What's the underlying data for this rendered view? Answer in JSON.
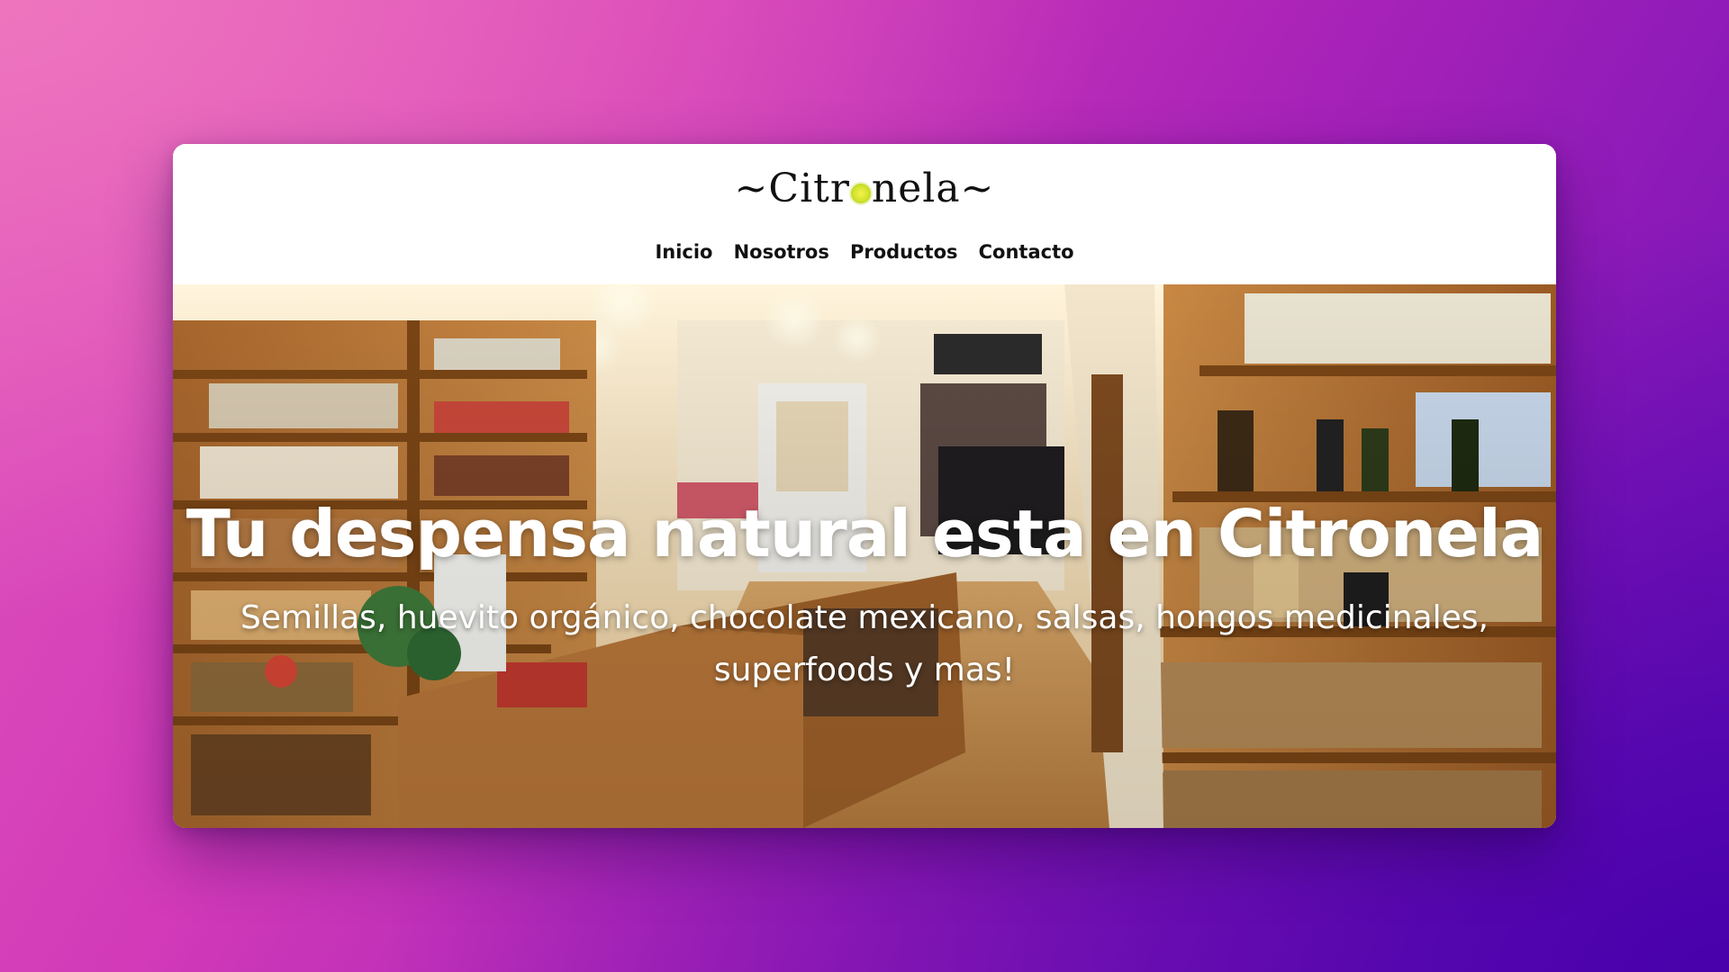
{
  "site": {
    "logo": {
      "prefix": "~Citr",
      "suffix": "nela~",
      "dot_icon": "lemon-slice-icon"
    },
    "nav": [
      {
        "label": "Inicio"
      },
      {
        "label": "Nosotros"
      },
      {
        "label": "Productos"
      },
      {
        "label": "Contacto"
      }
    ]
  },
  "hero": {
    "image": "shop-interior-photo",
    "title": "Tu despensa natural esta en Citronela",
    "subtitle": "Semillas, huevito orgánico, chocolate mexicano, salsas, hongos medicinales, superfoods y mas!"
  },
  "colors": {
    "background_gradient_start": "#e056bd",
    "background_gradient_end": "#6a10b8",
    "header_bg": "#ffffff",
    "nav_text": "#111111",
    "hero_text": "#ffffff",
    "logo_accent": "#cfe32d"
  }
}
